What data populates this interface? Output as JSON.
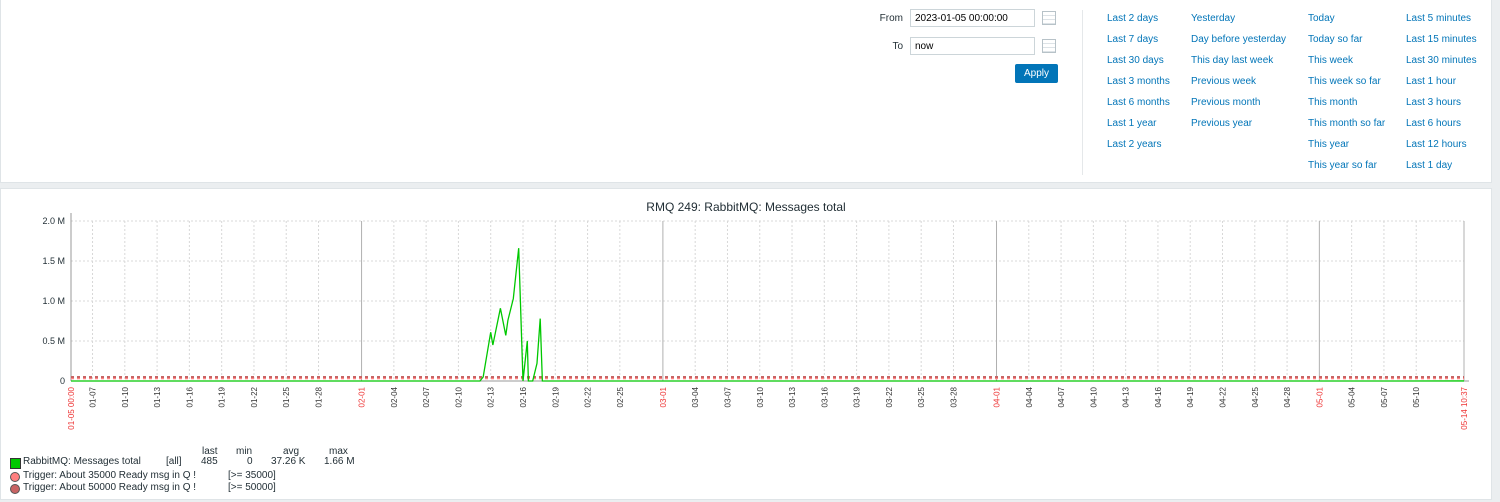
{
  "filter": {
    "from_label": "From",
    "from_value": "2023-01-05 00:00:00",
    "to_label": "To",
    "to_value": "now",
    "apply": "Apply",
    "quick": [
      [
        "Last 2 days",
        "Last 7 days",
        "Last 30 days",
        "Last 3 months",
        "Last 6 months",
        "Last 1 year",
        "Last 2 years"
      ],
      [
        "Yesterday",
        "Day before yesterday",
        "This day last week",
        "Previous week",
        "Previous month",
        "Previous year"
      ],
      [
        "Today",
        "Today so far",
        "This week",
        "This week so far",
        "This month",
        "This month so far",
        "This year",
        "This year so far"
      ],
      [
        "Last 5 minutes",
        "Last 15 minutes",
        "Last 30 minutes",
        "Last 1 hour",
        "Last 3 hours",
        "Last 6 hours",
        "Last 12 hours",
        "Last 1 day"
      ]
    ]
  },
  "chart_data": {
    "type": "line",
    "title": "RMQ 249: RabbitMQ: Messages total",
    "ylim": [
      0,
      2000000
    ],
    "yticks": [
      {
        "v": 0,
        "label": "0"
      },
      {
        "v": 500000,
        "label": "0.5 M"
      },
      {
        "v": 1000000,
        "label": "1.0 M"
      },
      {
        "v": 1500000,
        "label": "1.5 M"
      },
      {
        "v": 2000000,
        "label": "2.0 M"
      }
    ],
    "xrange_days": [
      0,
      129.44
    ],
    "xticks": [
      {
        "d": 0,
        "label": "01-05 00:00",
        "major": true
      },
      {
        "d": 2,
        "label": "01-07"
      },
      {
        "d": 5,
        "label": "01-10"
      },
      {
        "d": 8,
        "label": "01-13"
      },
      {
        "d": 11,
        "label": "01-16"
      },
      {
        "d": 14,
        "label": "01-19"
      },
      {
        "d": 17,
        "label": "01-22"
      },
      {
        "d": 20,
        "label": "01-25"
      },
      {
        "d": 23,
        "label": "01-28"
      },
      {
        "d": 27,
        "label": "02-01",
        "major": true
      },
      {
        "d": 30,
        "label": "02-04"
      },
      {
        "d": 33,
        "label": "02-07"
      },
      {
        "d": 36,
        "label": "02-10"
      },
      {
        "d": 39,
        "label": "02-13"
      },
      {
        "d": 42,
        "label": "02-16"
      },
      {
        "d": 45,
        "label": "02-19"
      },
      {
        "d": 48,
        "label": "02-22"
      },
      {
        "d": 51,
        "label": "02-25"
      },
      {
        "d": 55,
        "label": "03-01",
        "major": true
      },
      {
        "d": 58,
        "label": "03-04"
      },
      {
        "d": 61,
        "label": "03-07"
      },
      {
        "d": 64,
        "label": "03-10"
      },
      {
        "d": 67,
        "label": "03-13"
      },
      {
        "d": 70,
        "label": "03-16"
      },
      {
        "d": 73,
        "label": "03-19"
      },
      {
        "d": 76,
        "label": "03-22"
      },
      {
        "d": 79,
        "label": "03-25"
      },
      {
        "d": 82,
        "label": "03-28"
      },
      {
        "d": 86,
        "label": "04-01",
        "major": true
      },
      {
        "d": 89,
        "label": "04-04"
      },
      {
        "d": 92,
        "label": "04-07"
      },
      {
        "d": 95,
        "label": "04-10"
      },
      {
        "d": 98,
        "label": "04-13"
      },
      {
        "d": 101,
        "label": "04-16"
      },
      {
        "d": 104,
        "label": "04-19"
      },
      {
        "d": 107,
        "label": "04-22"
      },
      {
        "d": 110,
        "label": "04-25"
      },
      {
        "d": 113,
        "label": "04-28"
      },
      {
        "d": 116,
        "label": "05-01",
        "major": true
      },
      {
        "d": 119,
        "label": "05-04"
      },
      {
        "d": 122,
        "label": "05-07"
      },
      {
        "d": 125,
        "label": "05-10"
      },
      {
        "d": 129.44,
        "label": "05-14 10:37",
        "major": true
      }
    ],
    "series": [
      {
        "name": "RabbitMQ: Messages total",
        "color": "#00c800",
        "points": [
          [
            0,
            0
          ],
          [
            38.0,
            0
          ],
          [
            38.3,
            50000
          ],
          [
            39.0,
            610000
          ],
          [
            39.2,
            450000
          ],
          [
            39.9,
            910000
          ],
          [
            40.4,
            570000
          ],
          [
            40.6,
            760000
          ],
          [
            41.1,
            1030000
          ],
          [
            41.6,
            1660000
          ],
          [
            42.0,
            0
          ],
          [
            42.4,
            500000
          ],
          [
            42.5,
            0
          ],
          [
            42.9,
            0
          ],
          [
            43.3,
            220000
          ],
          [
            43.6,
            780000
          ],
          [
            43.8,
            0
          ],
          [
            129.44,
            485
          ]
        ]
      }
    ],
    "triggers": [
      {
        "value": 35000,
        "color": "#ff8080"
      },
      {
        "value": 50000,
        "color": "#c86464"
      }
    ]
  },
  "legend": {
    "headers": [
      "last",
      "min",
      "avg",
      "max"
    ],
    "item": "RabbitMQ: Messages total",
    "func": "[all]",
    "last": "485",
    "min": "0",
    "avg": "37.26 K",
    "max": "1.66 M",
    "triggers": [
      {
        "text": "Trigger: About 35000 Ready msg in Q !",
        "cond": "[>= 35000]"
      },
      {
        "text": "Trigger: About 50000 Ready msg in Q !",
        "cond": "[>= 50000]"
      }
    ]
  }
}
